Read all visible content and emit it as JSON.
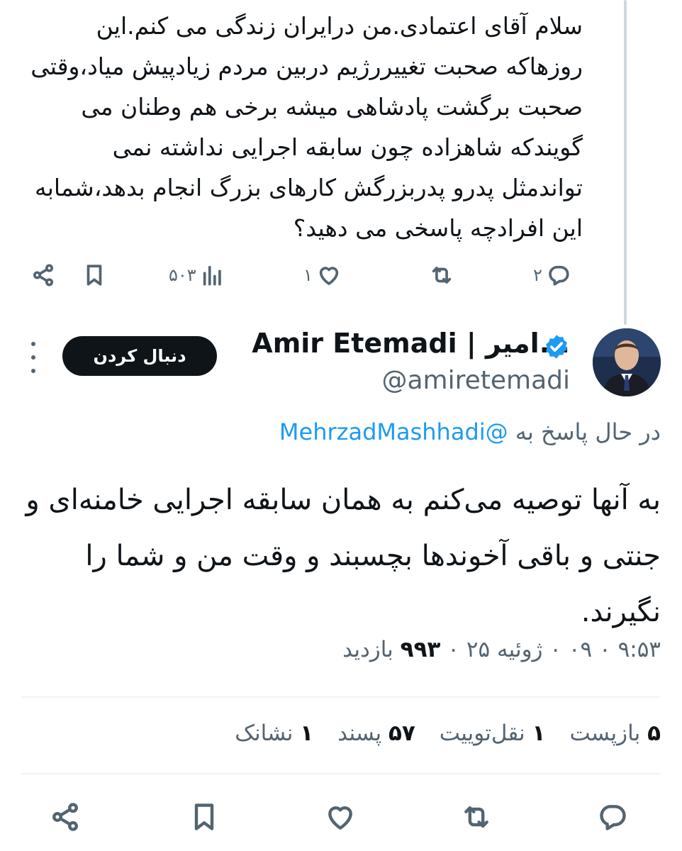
{
  "parent_tweet": {
    "text": "سلام آقای اعتمادی.من درایران زندگی می کنم.این روزهاکه صحبت تغییررژیم دربین مردم زیادپیش میاد،وقتی صحبت برگشت پادشاهی میشه برخی هم وطنان می گویندکه شاهزاده چون سابقه اجرایی نداشته نمی تواندمثل پدرو پدربزرگش کارهای بزرگ انجام بدهد،شمابه این افرادچه پاسخی می دهید؟",
    "counts": {
      "views": "۵۰۳",
      "likes": "۱",
      "replies": "۲"
    }
  },
  "author": {
    "display_name": "Amir Etemadi | امیر...",
    "handle": "@amiretemadi",
    "follow_label": "دنبال کردن"
  },
  "reply": {
    "replying_label": "در حال پاسخ به",
    "mention": "@MehrzadMashhadi",
    "text": "به آنها توصیه می‌کنم به همان سابقه اجرایی خامنه‌ای و جنتی و باقی آخوندها بچسبند و وقت من و شما را نگیرند.",
    "timestamp": "۹:۵۳ ۰ ۰۹ ۰ ژوئیه ۲۵ ۰",
    "views_count": "۹۹۳",
    "views_label": "بازدید"
  },
  "stats": {
    "reposts_count": "۵",
    "reposts_label": "بازپست",
    "quotes_count": "۱",
    "quotes_label": "نقل‌توییت",
    "likes_count": "۵۷",
    "likes_label": "پسند",
    "bookmarks_count": "۱",
    "bookmarks_label": "نشانک"
  },
  "colors": {
    "text": "#0f1419",
    "secondary": "#536471",
    "link": "#1d9bf0",
    "button_bg": "#0f1419",
    "divider": "#eff3f4"
  },
  "icons": [
    "share-icon",
    "bookmark-icon",
    "views-icon",
    "like-icon",
    "repost-icon",
    "reply-icon",
    "verified-badge-icon",
    "more-icon"
  ]
}
